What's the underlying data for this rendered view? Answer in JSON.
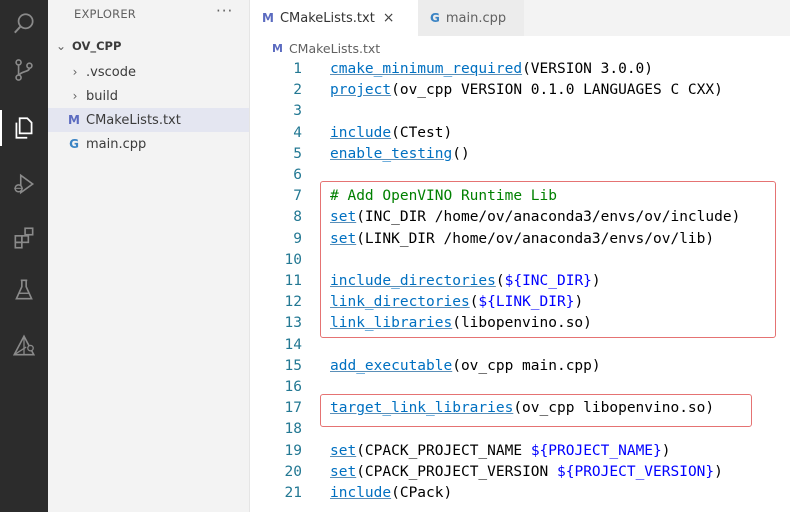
{
  "activity_bar": {
    "items": [
      {
        "icon": "search-icon"
      },
      {
        "icon": "source-control-icon"
      },
      {
        "icon": "explorer-files-icon",
        "active": true
      },
      {
        "icon": "run-debug-icon"
      },
      {
        "icon": "extensions-icon"
      },
      {
        "icon": "testing-flask-icon"
      },
      {
        "icon": "cmake-icon"
      }
    ]
  },
  "explorer": {
    "title": "EXPLORER",
    "more": "···",
    "root": "OV_CPP",
    "items": [
      {
        "label": ".vscode",
        "type": "folder"
      },
      {
        "label": "build",
        "type": "folder"
      },
      {
        "label": "CMakeLists.txt",
        "type": "cmake",
        "icon_glyph": "M",
        "selected": true
      },
      {
        "label": "main.cpp",
        "type": "cpp",
        "icon_glyph": "G"
      }
    ]
  },
  "tabs": [
    {
      "label": "CMakeLists.txt",
      "icon_glyph": "M",
      "active": true,
      "close": "×"
    },
    {
      "label": "main.cpp",
      "icon_glyph": "G",
      "active": false
    }
  ],
  "breadcrumb": {
    "icon_glyph": "M",
    "label": "CMakeLists.txt"
  },
  "code_lines": [
    {
      "n": "1",
      "tokens": [
        [
          "fn",
          "cmake_minimum_required"
        ],
        [
          "ident",
          "(VERSION 3.0.0)"
        ]
      ]
    },
    {
      "n": "2",
      "tokens": [
        [
          "fn",
          "project"
        ],
        [
          "ident",
          "(ov_cpp VERSION 0.1.0 LANGUAGES C CXX)"
        ]
      ]
    },
    {
      "n": "3",
      "tokens": []
    },
    {
      "n": "4",
      "tokens": [
        [
          "fn",
          "include"
        ],
        [
          "ident",
          "(CTest)"
        ]
      ]
    },
    {
      "n": "5",
      "tokens": [
        [
          "fn",
          "enable_testing"
        ],
        [
          "ident",
          "()"
        ]
      ]
    },
    {
      "n": "6",
      "tokens": []
    },
    {
      "n": "7",
      "tokens": [
        [
          "comment",
          "# Add OpenVINO Runtime Lib"
        ]
      ]
    },
    {
      "n": "8",
      "tokens": [
        [
          "fn",
          "set"
        ],
        [
          "ident",
          "(INC_DIR /home/ov/anaconda3/envs/ov/include)"
        ]
      ]
    },
    {
      "n": "9",
      "tokens": [
        [
          "fn",
          "set"
        ],
        [
          "ident",
          "(LINK_DIR /home/ov/anaconda3/envs/ov/lib)"
        ]
      ]
    },
    {
      "n": "10",
      "tokens": []
    },
    {
      "n": "11",
      "tokens": [
        [
          "fn",
          "include_directories"
        ],
        [
          "ident",
          "("
        ],
        [
          "str",
          "${INC_DIR}"
        ],
        [
          "ident",
          ")"
        ]
      ]
    },
    {
      "n": "12",
      "tokens": [
        [
          "fn",
          "link_directories"
        ],
        [
          "ident",
          "("
        ],
        [
          "str",
          "${LINK_DIR}"
        ],
        [
          "ident",
          ")"
        ]
      ]
    },
    {
      "n": "13",
      "tokens": [
        [
          "fn",
          "link_libraries"
        ],
        [
          "ident",
          "(libopenvino.so)"
        ]
      ]
    },
    {
      "n": "14",
      "tokens": []
    },
    {
      "n": "15",
      "tokens": [
        [
          "fn",
          "add_executable"
        ],
        [
          "ident",
          "(ov_cpp main.cpp)"
        ]
      ]
    },
    {
      "n": "16",
      "tokens": []
    },
    {
      "n": "17",
      "tokens": [
        [
          "fn",
          "target_link_libraries"
        ],
        [
          "ident",
          "(ov_cpp libopenvino.so)"
        ]
      ]
    },
    {
      "n": "18",
      "tokens": []
    },
    {
      "n": "19",
      "tokens": [
        [
          "fn",
          "set"
        ],
        [
          "ident",
          "(CPACK_PROJECT_NAME "
        ],
        [
          "str",
          "${PROJECT_NAME}"
        ],
        [
          "ident",
          ")"
        ]
      ]
    },
    {
      "n": "20",
      "tokens": [
        [
          "fn",
          "set"
        ],
        [
          "ident",
          "(CPACK_PROJECT_VERSION "
        ],
        [
          "str",
          "${PROJECT_VERSION}"
        ],
        [
          "ident",
          ")"
        ]
      ]
    },
    {
      "n": "21",
      "tokens": [
        [
          "fn",
          "include"
        ],
        [
          "ident",
          "(CPack)"
        ]
      ]
    }
  ],
  "colors": {
    "activity_bg": "#2c2c2c",
    "sidebar_bg": "#f3f3f3",
    "line_number": "#237893",
    "function": "#0070c1",
    "variable": "#0000ff",
    "comment": "#008000",
    "highlight_box": "#e57373",
    "cmake_icon": "#5b6bc0",
    "cpp_icon": "#3b84c4"
  }
}
